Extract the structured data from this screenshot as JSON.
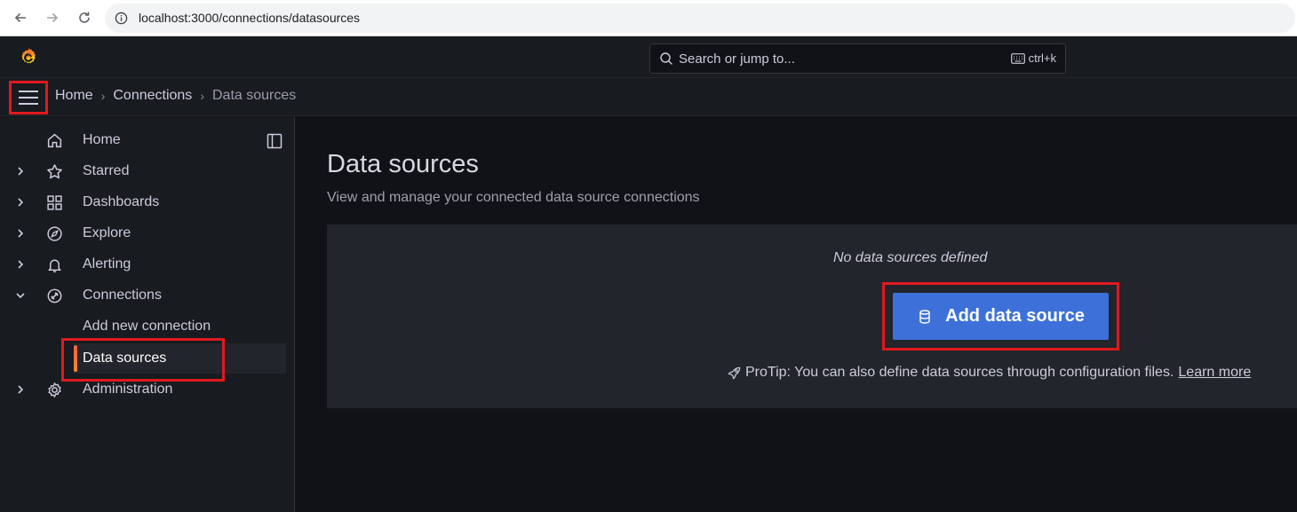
{
  "browser": {
    "url": "localhost:3000/connections/datasources"
  },
  "header": {
    "search_placeholder": "Search or jump to...",
    "search_shortcut": "ctrl+k"
  },
  "breadcrumb": {
    "items": [
      "Home",
      "Connections"
    ],
    "current": "Data sources"
  },
  "sidebar": {
    "items": [
      {
        "label": "Home",
        "icon": "home-icon"
      },
      {
        "label": "Starred",
        "icon": "star-icon"
      },
      {
        "label": "Dashboards",
        "icon": "apps-icon"
      },
      {
        "label": "Explore",
        "icon": "compass-icon"
      },
      {
        "label": "Alerting",
        "icon": "bell-icon"
      },
      {
        "label": "Connections",
        "icon": "connections-icon"
      },
      {
        "label": "Administration",
        "icon": "cog-icon"
      }
    ],
    "sub_items": [
      {
        "label": "Add new connection"
      },
      {
        "label": "Data sources"
      }
    ]
  },
  "main": {
    "title": "Data sources",
    "subtitle": "View and manage your connected data source connections",
    "empty_text": "No data sources defined",
    "add_button_label": "Add data source",
    "protip_text": "ProTip: You can also define data sources through configuration files.",
    "protip_link": "Learn more"
  },
  "colors": {
    "accent_button": "#3d71d9",
    "active_indicator": "#ff7b29",
    "annotation_box": "#e0191f"
  }
}
